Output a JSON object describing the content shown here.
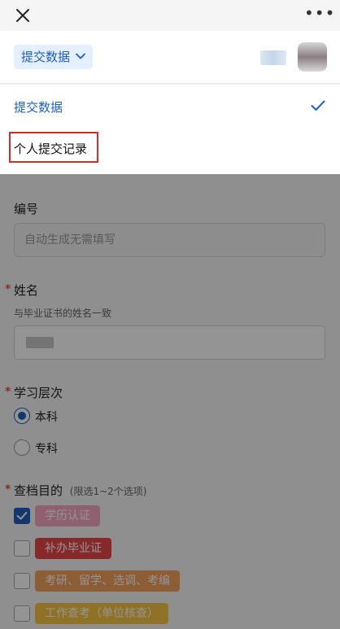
{
  "topbar": {
    "more_glyph": "•••"
  },
  "header": {
    "selector_label": "提交数据"
  },
  "dropdown": {
    "options": [
      {
        "label": "提交数据",
        "selected": true
      },
      {
        "label": "个人提交记录",
        "highlighted": true
      }
    ]
  },
  "form": {
    "number": {
      "label": "编号",
      "placeholder": "自动生成无需填写"
    },
    "name": {
      "label": "姓名",
      "hint": "与毕业证书的姓名一致"
    },
    "level": {
      "label": "学习层次",
      "options": [
        "本科",
        "专科"
      ],
      "selected": "本科"
    },
    "purpose": {
      "label": "查档目的",
      "note": "(限选1~2个选项)",
      "options": [
        {
          "label": "学历认证",
          "checked": true,
          "color": "#f6a5c0"
        },
        {
          "label": "补办毕业证",
          "checked": false,
          "color": "#e8474b"
        },
        {
          "label": "考研、留学、选调、考编",
          "checked": false,
          "color": "#f3a05c"
        },
        {
          "label": "工作查考（单位核查）",
          "checked": false,
          "color": "#f6c443"
        }
      ]
    }
  },
  "colors": {
    "accent": "#1f5fbf",
    "required": "#d9241c",
    "highlight_box": "#c9302c"
  }
}
